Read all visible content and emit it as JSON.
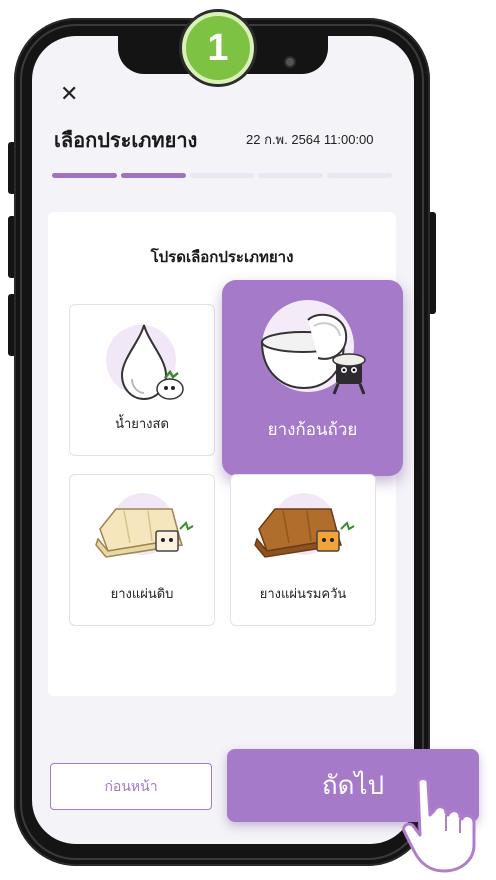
{
  "step_badge": "1",
  "header": {
    "title": "เลือกประเภทยาง",
    "datetime": "22 ก.พ. 2564  11:00:00"
  },
  "progress": {
    "total_steps": 5,
    "completed_steps": 2
  },
  "card": {
    "heading": "โปรดเลือกประเภทยาง",
    "options": [
      {
        "label": "น้ำยางสด",
        "selected": false,
        "icon": "latex-drop-icon"
      },
      {
        "label": "ยางก้อนถ้วย",
        "selected": true,
        "icon": "cup-lump-icon"
      },
      {
        "label": "ยางแผ่นดิบ",
        "selected": false,
        "icon": "raw-sheet-icon"
      },
      {
        "label": "ยางแผ่นรมควัน",
        "selected": false,
        "icon": "smoked-sheet-icon"
      }
    ]
  },
  "buttons": {
    "back": "ก่อนหน้า",
    "next": "ถัดไป"
  },
  "colors": {
    "accent": "#a47ac9",
    "step_badge": "#7dc242"
  }
}
